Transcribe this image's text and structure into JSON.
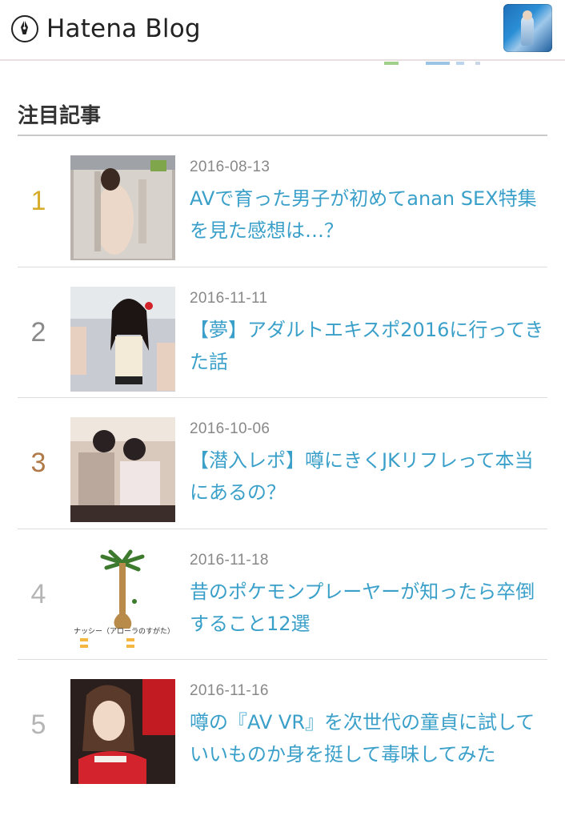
{
  "header": {
    "logo_text": "Hatena Blog",
    "logo_icon": "hatena-pen-icon",
    "avatar_icon": "user-avatar"
  },
  "section": {
    "title": "注目記事"
  },
  "colors": {
    "link": "#3aa0c9",
    "rank_gold": "#d6ad2b",
    "rank_silver": "#8a8a8a",
    "rank_bronze": "#b07a48",
    "rank_default": "#b5b5b5"
  },
  "articles": [
    {
      "rank": "1",
      "date": "2016-08-13",
      "title": "AVで育った男子が初めてanan SEX特集を見た感想は…？",
      "thumb": "magazine-cover-thumbnail"
    },
    {
      "rank": "2",
      "date": "2016-11-11",
      "title": "【夢】アダルトエキスポ2016に行ってきた話",
      "thumb": "expo-photo-thumbnail"
    },
    {
      "rank": "3",
      "date": "2016-10-06",
      "title": "【潜入レポ】噂にきくJKリフレって本当にあるの？",
      "thumb": "room-photo-thumbnail"
    },
    {
      "rank": "4",
      "date": "2016-11-18",
      "title": "昔のポケモンプレーヤーが知ったら卒倒すること12選",
      "thumb": "pokemon-thumbnail",
      "thumb_caption": "ナッシー（アローラのすがた）"
    },
    {
      "rank": "5",
      "date": "2016-11-16",
      "title": "噂の『AV VR』を次世代の童貞に試していいものか身を挺して毒味してみた",
      "thumb": "portrait-photo-thumbnail"
    }
  ]
}
